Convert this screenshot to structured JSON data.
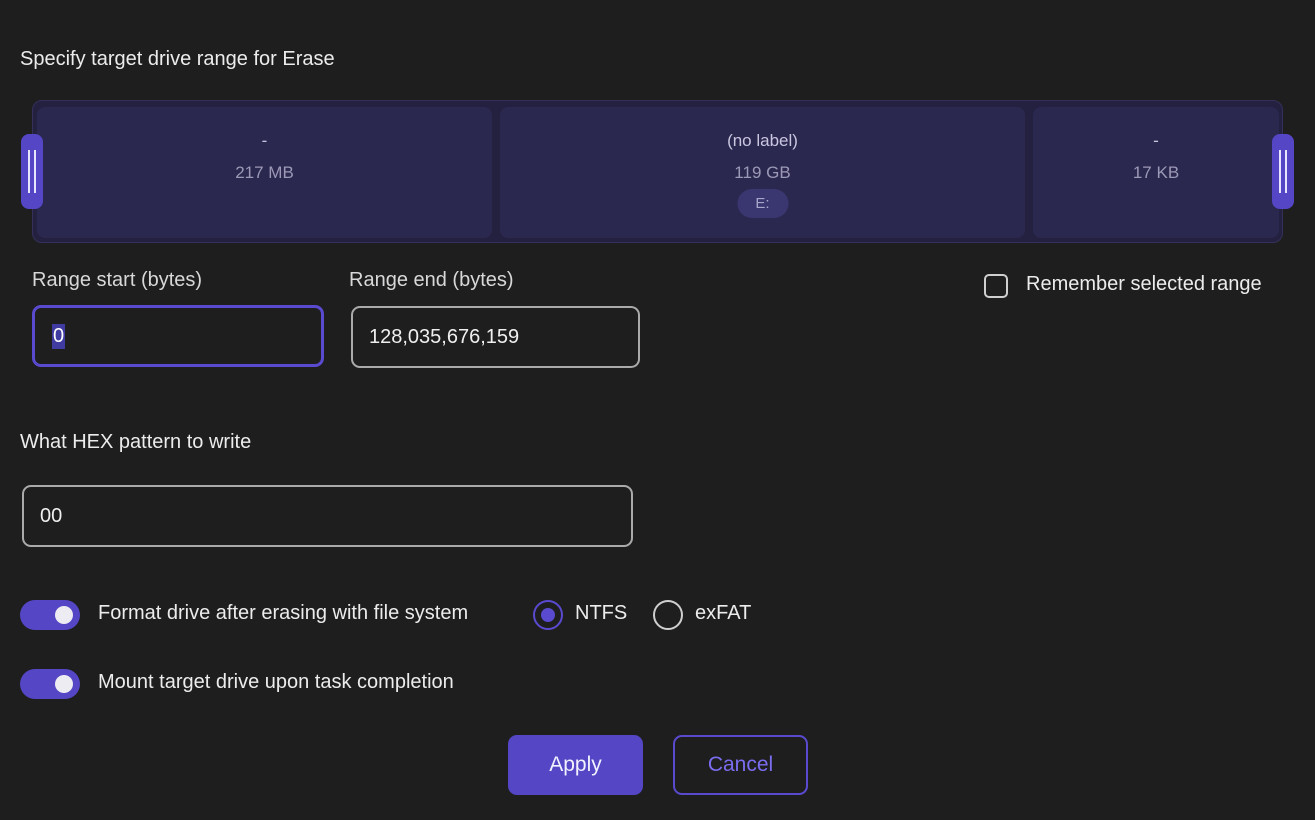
{
  "range_title": "Specify target drive range for Erase",
  "partitions": [
    {
      "name": "-",
      "size": "217 MB"
    },
    {
      "name": "(no label)",
      "size": "119 GB",
      "letter": "E:"
    },
    {
      "name": "-",
      "size": "17 KB"
    }
  ],
  "range": {
    "start_label": "Range start (bytes)",
    "start_value": "0",
    "end_label": "Range end (bytes)",
    "end_value": "128,035,676,159",
    "remember_label": "Remember selected range",
    "remember_checked": false
  },
  "hex": {
    "title": "What HEX pattern to write",
    "value": "00"
  },
  "options": {
    "format_label": "Format drive after erasing with file system",
    "format_enabled": true,
    "fs_options": [
      "NTFS",
      "exFAT"
    ],
    "fs_selected": "NTFS",
    "mount_label": "Mount target drive upon task completion",
    "mount_enabled": true
  },
  "buttons": {
    "apply": "Apply",
    "cancel": "Cancel"
  },
  "colors": {
    "background": "#1e1e1e",
    "accent": "#5446c4",
    "bar": "#242040"
  }
}
